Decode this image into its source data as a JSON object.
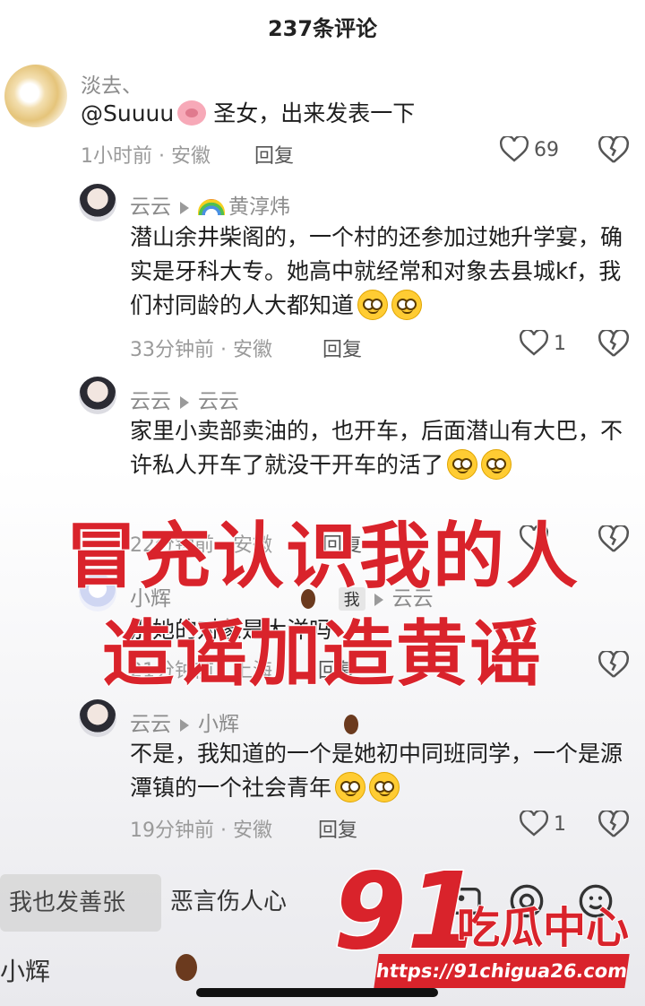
{
  "header": {
    "title": "237条评论"
  },
  "comments": [
    {
      "user": "淡去、",
      "text_mention": "@Suuuu",
      "text": "圣女，出来发表一下",
      "meta": "1小时前 · 安徽",
      "reply_label": "回复",
      "likes": "69"
    },
    {
      "user": "云云",
      "reply_to": "黄淳炜",
      "text": "潜山余井柴阁的，一个村的还参加过她升学宴，确实是牙科大专。她高中就经常和对象去县城kf，我们村同龄的人大都知道",
      "meta": "33分钟前 · 安徽",
      "reply_label": "回复",
      "likes": "1"
    },
    {
      "user": "云云",
      "reply_to": "云云",
      "text": "家里小卖部卖油的，也开车，后面潜山有大巴，不许私人开车了就没干开车的活了",
      "meta": "22分钟前 · 安徽",
      "reply_label": "回复",
      "likes": ""
    },
    {
      "user": "小辉",
      "author_badge": "我",
      "reply_to": "云云",
      "text": "那她的对象是大洋吗",
      "meta": "21分钟前 · 上海",
      "reply_label": "回复",
      "likes": ""
    },
    {
      "user": "云云",
      "reply_to": "小辉",
      "text": "不是，我知道的一个是她初中同班同学，一个是源潭镇的一个社会青年",
      "meta": "19分钟前 · 安徽",
      "reply_label": "回复",
      "likes": "1"
    }
  ],
  "overlay": {
    "line1": "冒充认识我的人",
    "line2": "造谣加造黄谣"
  },
  "bottom": {
    "input_left": "我也发善张",
    "input_placeholder": "恶言伤人心",
    "name": "小辉"
  },
  "watermark": {
    "logo_number": "91",
    "logo_text": "吃瓜中心",
    "url": "https://91chigua26.com"
  },
  "colors": {
    "overlay_red": "#d9232b",
    "muted": "#9a9a9a"
  },
  "icons": [
    "heart-icon",
    "broken-heart-icon",
    "image-icon",
    "at-icon",
    "emoji-icon",
    "cockroach-icon",
    "pig-emoji",
    "rainbow-emoji",
    "grin-emoji"
  ]
}
